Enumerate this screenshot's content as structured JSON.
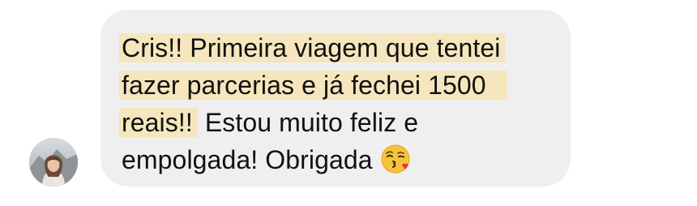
{
  "conversation": {
    "message": {
      "line1": "Cris!! Primeira viagem que tentei",
      "line2": "fazer parcerias e já fechei 1500",
      "line3_highlight": "reais!!",
      "line3_rest": " Estou muito feliz e",
      "line4": "empolgada! Obrigada",
      "emoji": "face-blowing-a-kiss-emoji",
      "highlight_color": "#f6e6bd"
    },
    "bubble_color": "#efefef",
    "avatar": "sender-avatar-photo"
  }
}
